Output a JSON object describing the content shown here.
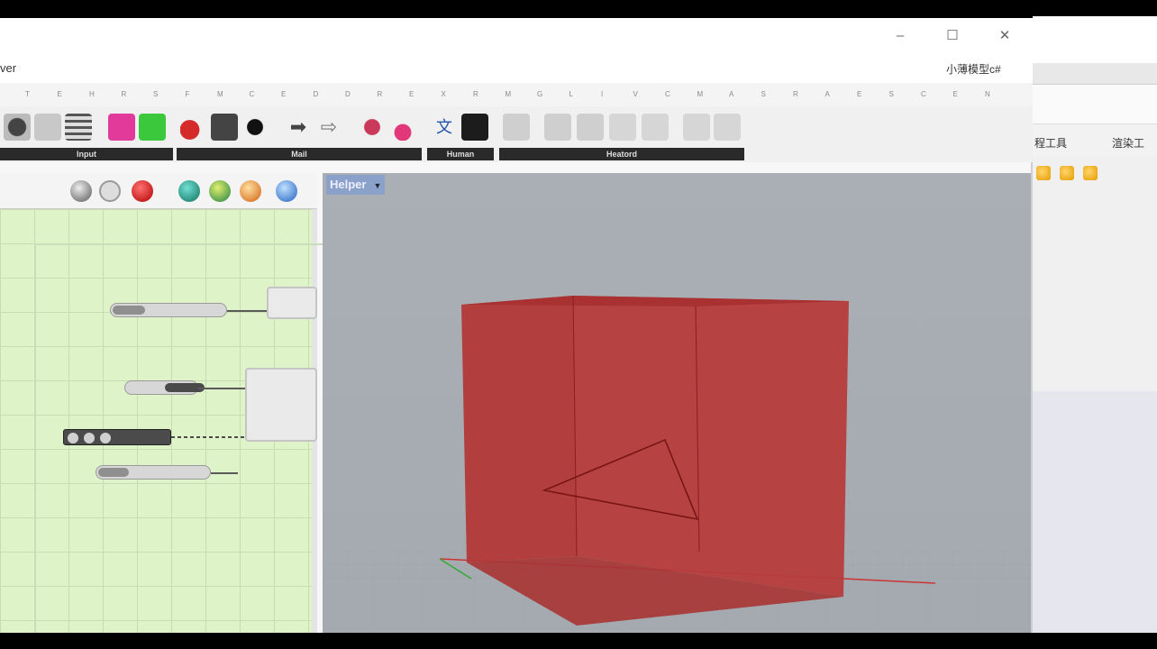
{
  "window": {
    "title_fragment": "ver",
    "right_label": "小薄模型c#"
  },
  "tab_letters": [
    "T",
    "E",
    "H",
    "R",
    "S",
    "F",
    "M",
    "C",
    "E",
    "D",
    "D",
    "R",
    "E",
    "X",
    "R",
    "M",
    "G",
    "L",
    "I",
    "V",
    "C",
    "M",
    "A",
    "S",
    "R",
    "A",
    "E",
    "S",
    "C",
    "E",
    "N"
  ],
  "ribbon": {
    "groups": [
      {
        "label": "Input"
      },
      {
        "label": "Mail"
      },
      {
        "label": "Human"
      },
      {
        "label": "Heatord"
      }
    ]
  },
  "viewport": {
    "label": "Helper",
    "dropdown_glyph": "▼"
  },
  "rhino_background": {
    "tab1": "程工具",
    "tab2": "渲染工"
  },
  "colors": {
    "canvas_bg": "#dff3c9",
    "viewport_bg": "#a9afb5",
    "box_fill": "#b23a3a",
    "box_edge": "#8a1f1f",
    "label_bg": "#8aa1c9"
  }
}
